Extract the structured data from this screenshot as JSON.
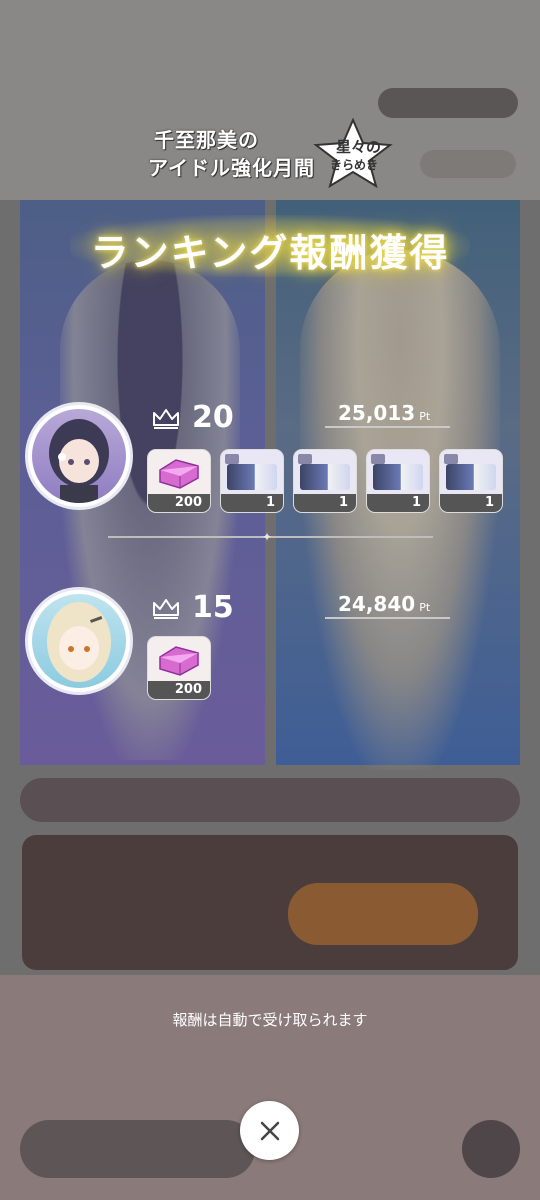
{
  "event_logo": {
    "line1": "千至那美の",
    "line2": "アイドル強化月間",
    "star_line1": "星々の",
    "star_line2": "きらめき"
  },
  "title": "ランキング報酬獲得",
  "rankings": [
    {
      "rank": "20",
      "points": "25,013",
      "points_unit": "Pt",
      "rewards": [
        {
          "icon": "gem-icon",
          "count": "200"
        },
        {
          "icon": "ticket-icon",
          "count": "1"
        },
        {
          "icon": "ticket-icon",
          "count": "1"
        },
        {
          "icon": "ticket-icon",
          "count": "1"
        },
        {
          "icon": "ticket-icon",
          "count": "1"
        }
      ]
    },
    {
      "rank": "15",
      "points": "24,840",
      "points_unit": "Pt",
      "rewards": [
        {
          "icon": "gem-icon",
          "count": "200"
        }
      ]
    }
  ],
  "note": "報酬は自動で受け取られます",
  "close_icon": "close-icon"
}
